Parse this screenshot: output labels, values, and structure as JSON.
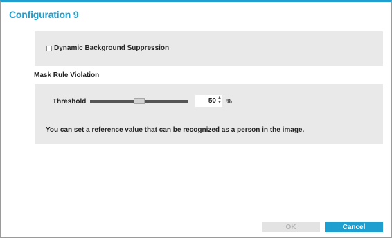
{
  "dialog": {
    "title": "Configuration 9"
  },
  "options": {
    "dynamic_bg_label": "Dynamic Background Suppression",
    "dynamic_bg_checked": false
  },
  "mask_rule": {
    "section_label": "Mask Rule Violation",
    "threshold_label": "Threshold",
    "threshold_value": "50",
    "threshold_fraction": 0.5,
    "unit": "%",
    "hint": "You can set a reference value that can be recognized as a person in the image."
  },
  "buttons": {
    "ok_label": "OK",
    "cancel_label": "Cancel"
  },
  "colors": {
    "accent": "#1f9fcf",
    "panel": "#e9e9e9"
  },
  "icons": {
    "checkbox": "checkbox-icon",
    "spin_up": "chevron-up-icon",
    "spin_down": "chevron-down-icon"
  }
}
